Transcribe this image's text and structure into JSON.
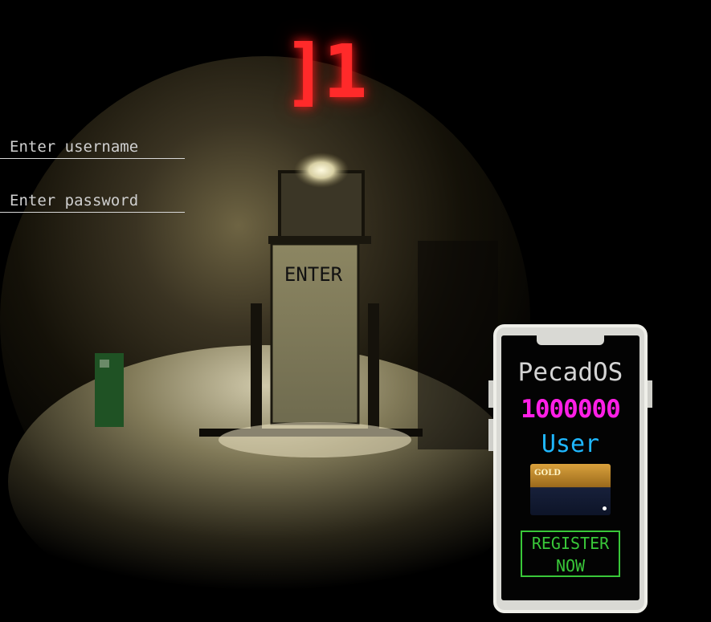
{
  "header": {
    "logo_text": "]1",
    "logo_color": "#ff2a2a"
  },
  "login": {
    "username_placeholder": "Enter username",
    "password_placeholder": "Enter password",
    "username_value": "",
    "password_value": ""
  },
  "scene": {
    "door_label": "ENTER"
  },
  "phone": {
    "os_name": "PecadOS",
    "balance": "1000000",
    "role": "User",
    "card_label": "GOLD",
    "register_line1": "REGISTER",
    "register_line2": "NOW",
    "colors": {
      "os_name": "#d4d4d4",
      "balance": "#ff1fe6",
      "role": "#1fb7ff",
      "register": "#39c739"
    }
  }
}
